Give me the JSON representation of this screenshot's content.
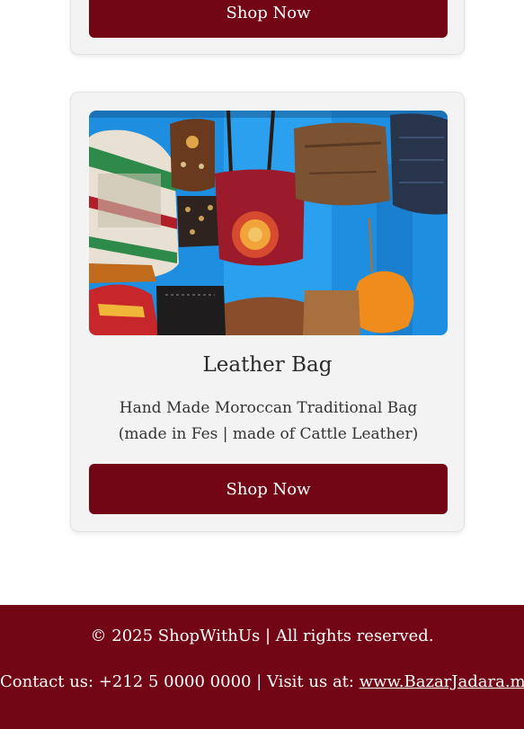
{
  "cards": [
    {
      "button_label": "Shop Now"
    },
    {
      "title": "Leather Bag",
      "description": "Hand Made Moroccan Traditional Bag (made in Fes | made of Cattle Leather)",
      "button_label": "Shop Now",
      "image": "leather-bags-photo"
    }
  ],
  "footer": {
    "copyright": "© 2025 ShopWithUs | All rights reserved.",
    "contact_prefix": "Contact us: +212 5 0000 0000 | Visit us at: ",
    "link_text": "www.BazarJadara.ma"
  },
  "colors": {
    "accent": "#720615",
    "card_bg": "#f3f3f3",
    "page_bg": "#ffffff"
  }
}
